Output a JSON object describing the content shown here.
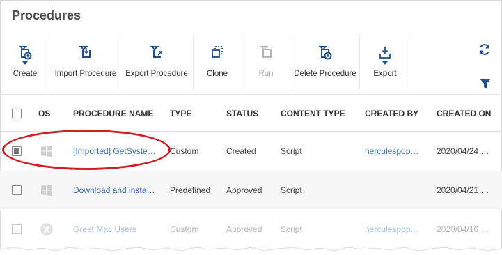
{
  "page": {
    "title": "Procedures"
  },
  "toolbar": {
    "buttons": [
      {
        "label": "Create",
        "icon": "create-procedure-icon",
        "has_dropdown": true,
        "enabled": true
      },
      {
        "label": "Import Procedure",
        "icon": "import-procedure-icon",
        "has_dropdown": false,
        "enabled": true
      },
      {
        "label": "Export Procedure",
        "icon": "export-procedure-icon",
        "has_dropdown": false,
        "enabled": true
      },
      {
        "label": "Clone",
        "icon": "clone-icon",
        "has_dropdown": false,
        "enabled": true
      },
      {
        "label": "Run",
        "icon": "run-icon",
        "has_dropdown": false,
        "enabled": false
      },
      {
        "label": "Delete Procedure",
        "icon": "delete-procedure-icon",
        "has_dropdown": false,
        "enabled": true
      },
      {
        "label": "Export",
        "icon": "export-icon",
        "has_dropdown": true,
        "enabled": true
      }
    ],
    "right_icons": [
      "refresh-icon",
      "filter-icon"
    ]
  },
  "table": {
    "columns": [
      "OS",
      "PROCEDURE NAME",
      "TYPE",
      "STATUS",
      "CONTENT TYPE",
      "CREATED BY",
      "CREATED ON"
    ],
    "rows": [
      {
        "os": "windows-icon",
        "name": "[Imported] GetSyste…",
        "type": "Custom",
        "status": "Created",
        "content_type": "Script",
        "created_by": "herculespop…",
        "created_on": "2020/04/24 …",
        "checked": true,
        "faded": false
      },
      {
        "os": "windows-icon",
        "name": "Download and insta…",
        "type": "Predefined",
        "status": "Approved",
        "content_type": "Script",
        "created_by": "",
        "created_on": "2020/04/21 …",
        "checked": false,
        "faded": false
      },
      {
        "os": "mac-icon",
        "name": "Greet Mac Users",
        "type": "Custom",
        "status": "Approved",
        "content_type": "Script",
        "created_by": "herculespop…",
        "created_on": "2020/04/16 …",
        "checked": false,
        "faded": true
      }
    ]
  },
  "colors": {
    "link": "#3a6fb0",
    "icon": "#1f4f88",
    "annotation": "#d21f26"
  }
}
